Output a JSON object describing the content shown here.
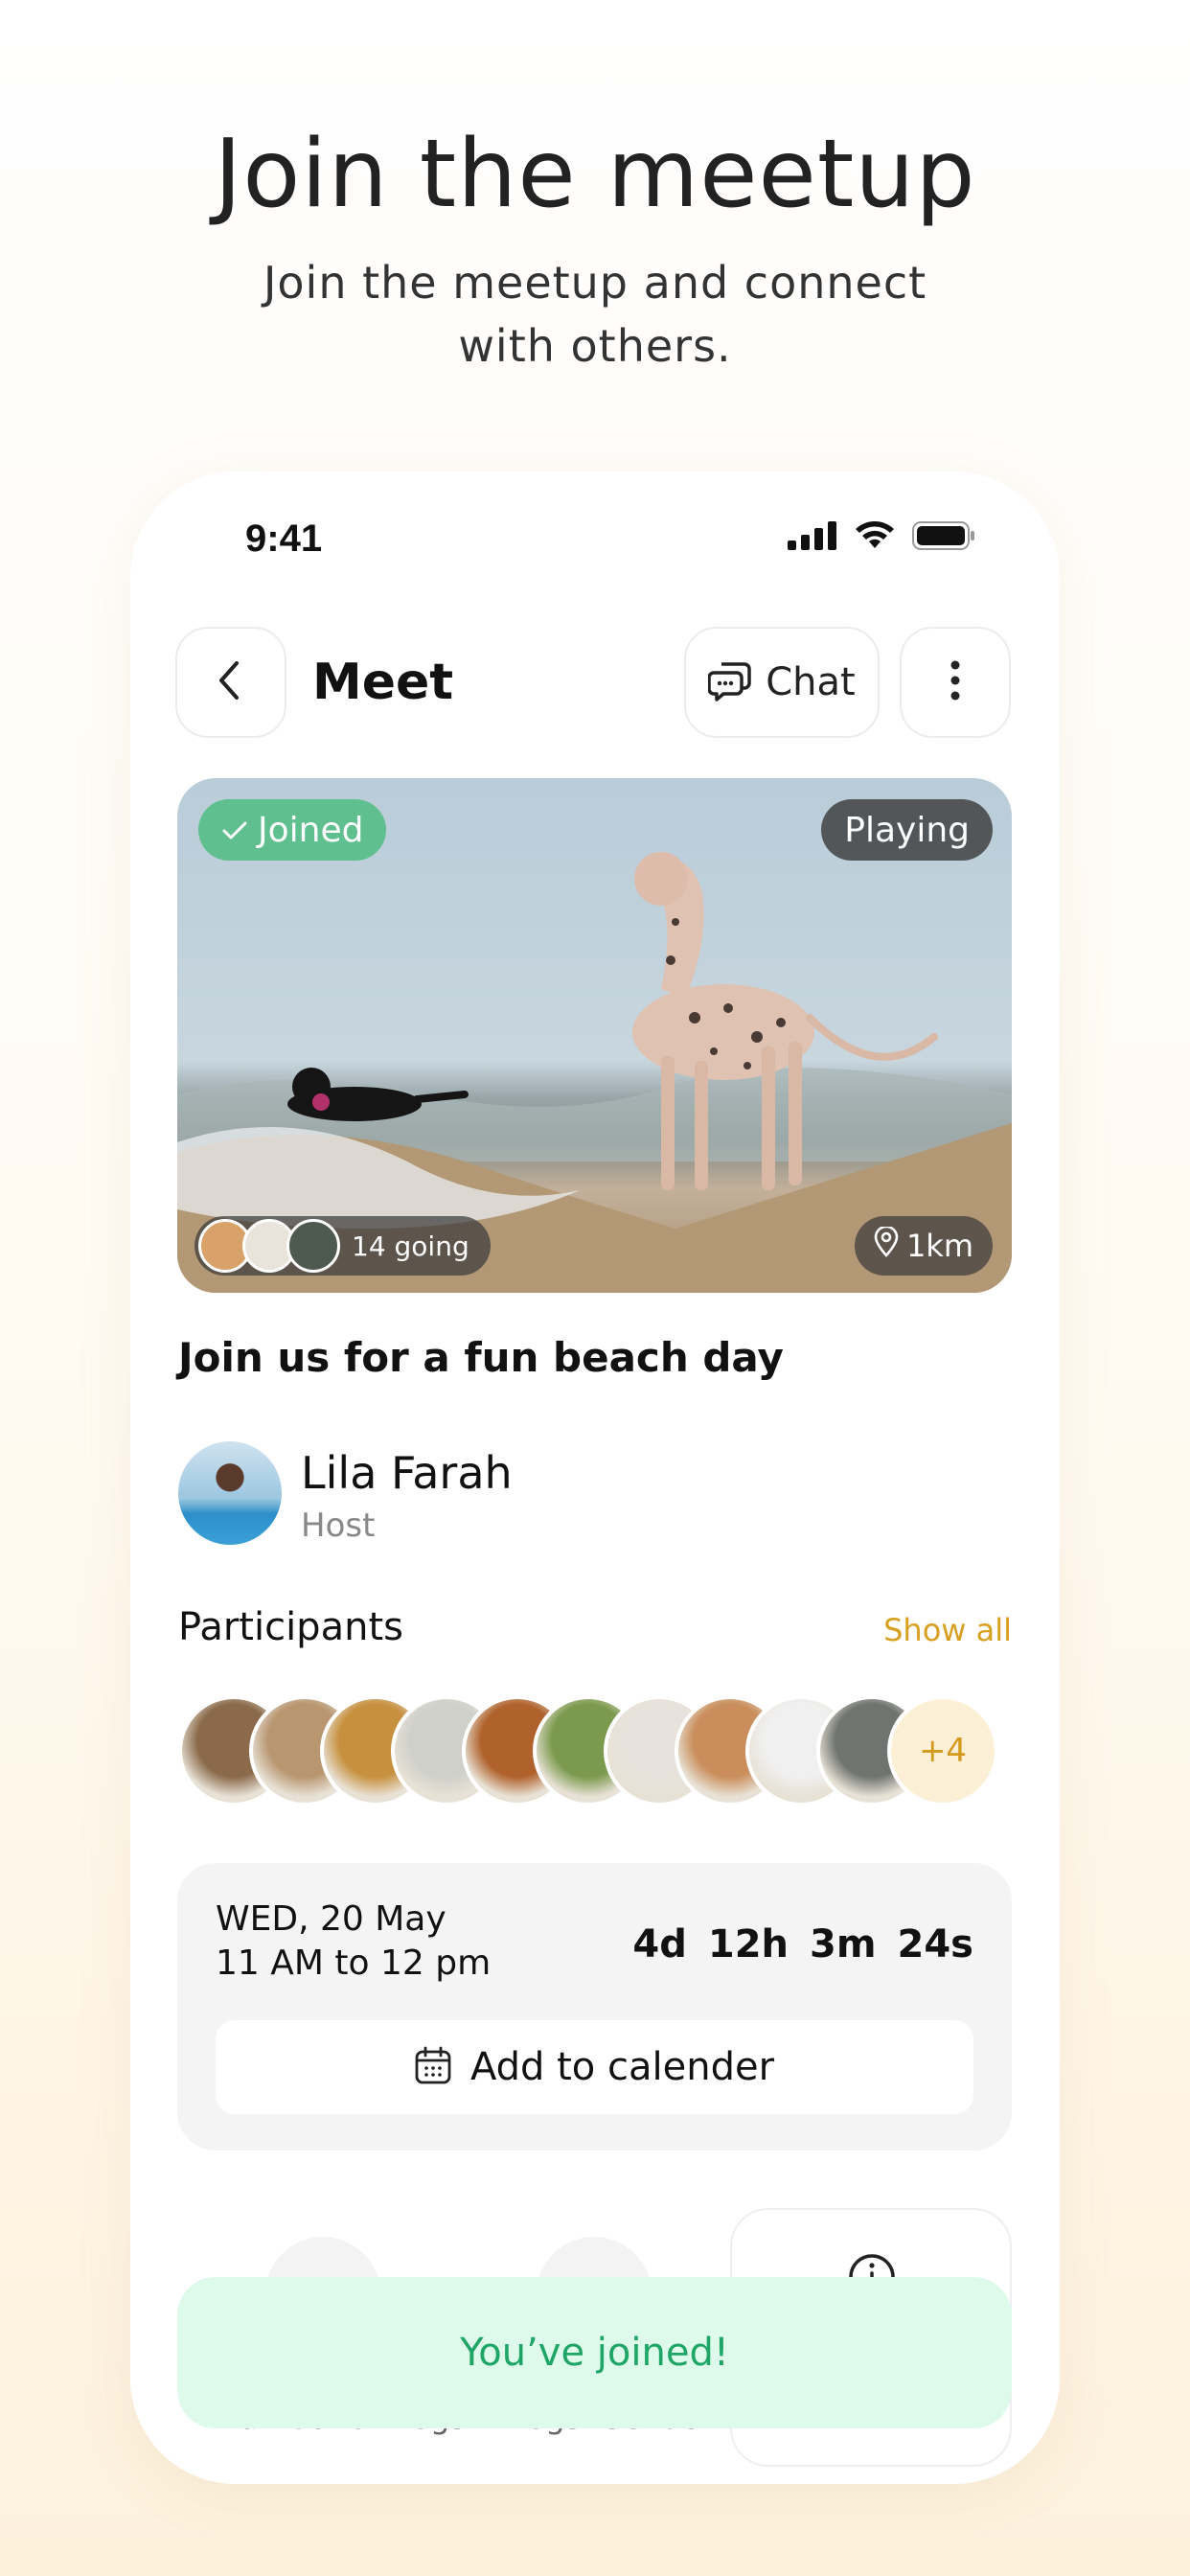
{
  "hero": {
    "title": "Join the meetup",
    "subtitle": "Join the meetup and connect with others."
  },
  "status_bar": {
    "time": "9:41"
  },
  "header": {
    "title": "Meet",
    "chat_label": "Chat",
    "back_icon": "chevron-left-icon",
    "more_icon": "more-vertical-icon",
    "chat_icon": "chat-bubbles-icon"
  },
  "photo": {
    "joined_label": "Joined",
    "activity_label": "Playing",
    "going_label": "14 going",
    "distance_label": "1km"
  },
  "event": {
    "title": "Join us for a fun beach day"
  },
  "host": {
    "name": "Lila Farah",
    "role": "Host"
  },
  "participants": {
    "label": "Participants",
    "show_all": "Show all",
    "more_count": "+4",
    "avatar_colors": [
      "#8a6a4a",
      "#b89670",
      "#c7903e",
      "#cfd0ca",
      "#b0622c",
      "#7c9a4e",
      "#e7e3dc",
      "#c98e5b",
      "#f0f0f0",
      "#6f7470"
    ]
  },
  "schedule": {
    "date": "WED, 20 May",
    "time": "11 AM to 12 pm",
    "countdown": {
      "days": "4d",
      "hours": "12h",
      "minutes": "3m",
      "seconds": "24s"
    },
    "add_calendar_label": "Add to calender"
  },
  "stats": {
    "dogs_label": "Number of Dogs",
    "gender_label": "Dogs' Gender"
  },
  "toast": {
    "message": "You’ve joined!"
  },
  "colors": {
    "accent_gold": "#d8a020",
    "joined_green": "#5fbf8f",
    "toast_bg": "#defaeb",
    "toast_text": "#1fa566"
  }
}
